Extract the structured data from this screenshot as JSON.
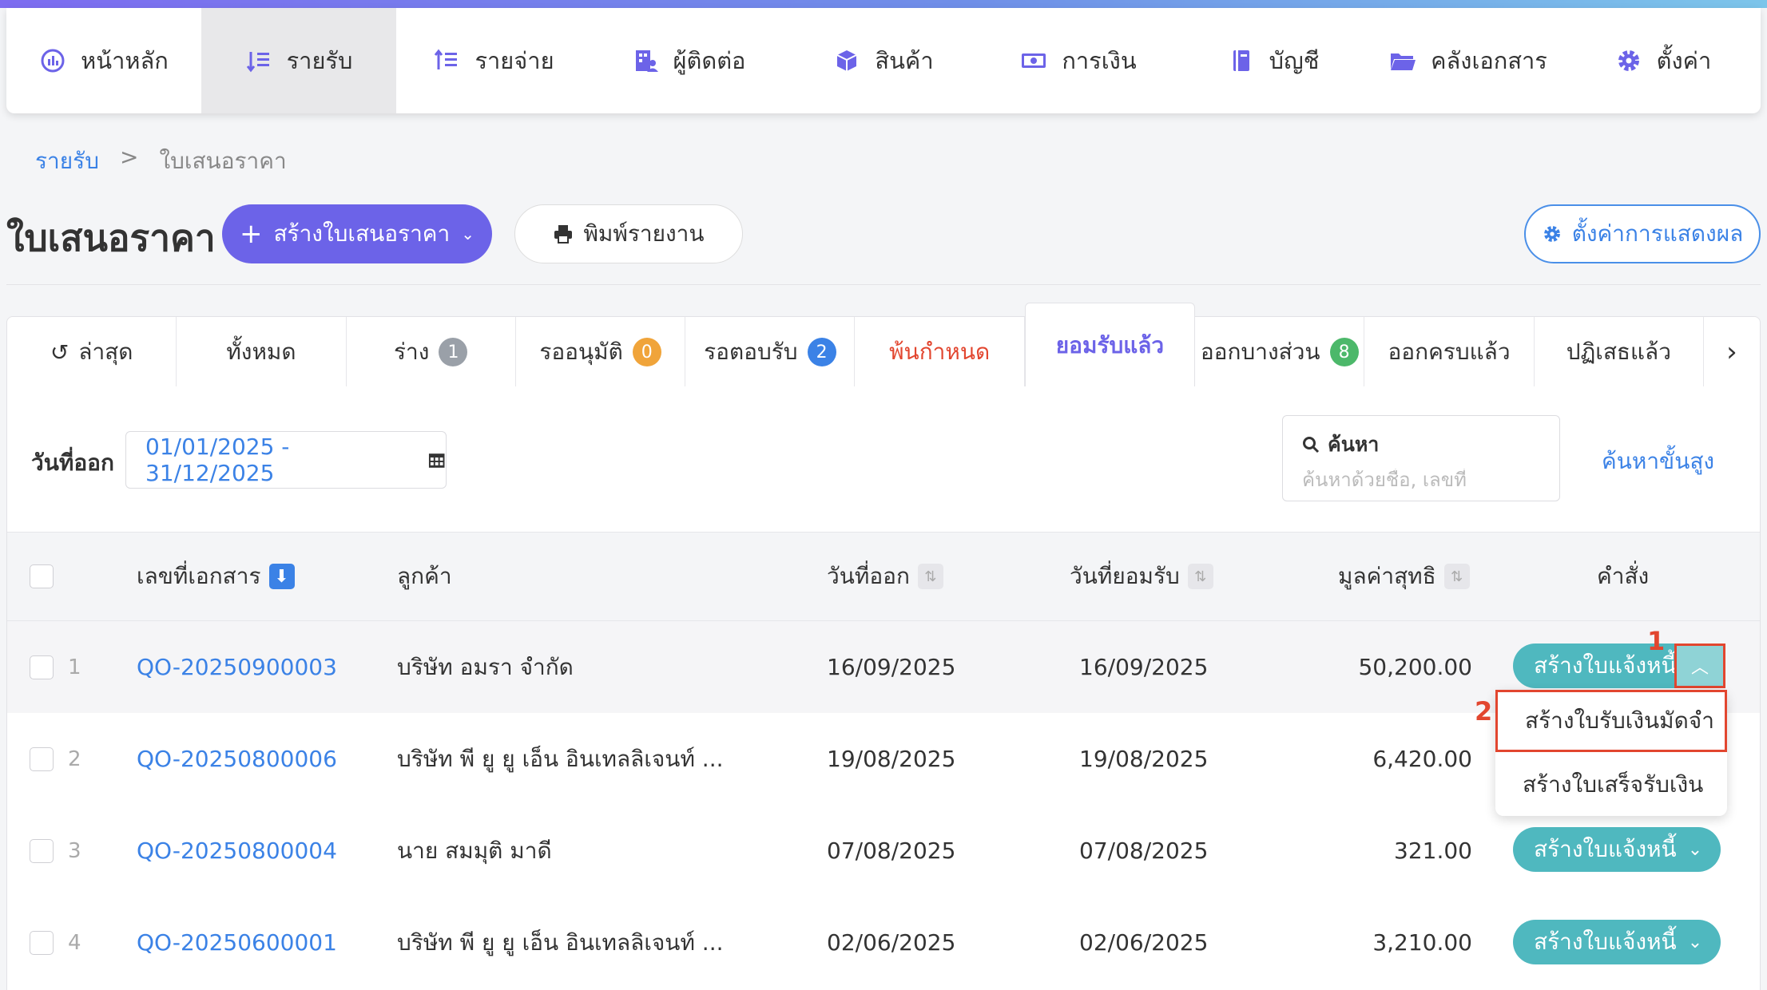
{
  "nav": [
    {
      "label": "หน้าหลัก",
      "icon": "dashboard-icon",
      "active": false
    },
    {
      "label": "รายรับ",
      "icon": "income-icon",
      "active": true
    },
    {
      "label": "รายจ่าย",
      "icon": "expense-icon",
      "active": false
    },
    {
      "label": "ผู้ติดต่อ",
      "icon": "contacts-icon",
      "active": false
    },
    {
      "label": "สินค้า",
      "icon": "box-icon",
      "active": false
    },
    {
      "label": "การเงิน",
      "icon": "money-icon",
      "active": false
    },
    {
      "label": "บัญชี",
      "icon": "ledger-icon",
      "active": false
    },
    {
      "label": "คลังเอกสาร",
      "icon": "folder-icon",
      "active": false
    },
    {
      "label": "ตั้งค่า",
      "icon": "gear-icon",
      "active": false
    }
  ],
  "breadcrumb": {
    "parent": "รายรับ",
    "sep": ">",
    "current": "ใบเสนอราคา"
  },
  "header": {
    "title": "ใบเสนอราคา",
    "create_label": "สร้างใบเสนอราคา",
    "print_label": "พิมพ์รายงาน",
    "settings_label": "ตั้งค่าการแสดงผล"
  },
  "tabs": [
    {
      "label": "ล่าสุด",
      "badge": null
    },
    {
      "label": "ทั้งหมด",
      "badge": null
    },
    {
      "label": "ร่าง",
      "badge": "1",
      "badge_color": "#9aa0a8"
    },
    {
      "label": "รออนุมัติ",
      "badge": "0",
      "badge_color": "#f0a43a"
    },
    {
      "label": "รอตอบรับ",
      "badge": "2",
      "badge_color": "#3b82e6"
    },
    {
      "label": "พ้นกำหนด",
      "badge": null
    },
    {
      "label": "ยอมรับแล้ว",
      "badge": null
    },
    {
      "label": "ออกบางส่วน",
      "badge": "8",
      "badge_color": "#4cb86a"
    },
    {
      "label": "ออกครบแล้ว",
      "badge": null
    },
    {
      "label": "ปฏิเสธแล้ว",
      "badge": null
    }
  ],
  "filters": {
    "date_label": "วันที่ออก",
    "date_range": "01/01/2025 - 31/12/2025",
    "search_label": "ค้นหา",
    "search_placeholder": "ค้นหาด้วยชื่อ, เลขที่",
    "advanced_label": "ค้นหาขั้นสูง"
  },
  "table": {
    "headers": {
      "doc_no": "เลขที่เอกสาร",
      "customer": "ลูกค้า",
      "issue_date": "วันที่ออก",
      "accept_date": "วันที่ยอมรับ",
      "net_value": "มูลค่าสุทธิ",
      "action": "คำสั่ง"
    },
    "rows": [
      {
        "n": "1",
        "doc": "QO-20250900003",
        "customer": "บริษัท อมรา จำกัด",
        "issue": "16/09/2025",
        "accept": "16/09/2025",
        "value": "50,200.00"
      },
      {
        "n": "2",
        "doc": "QO-20250800006",
        "customer": "บริษัท พี ยู ยู เอ็น อินเทลลิเจนท์ ...",
        "issue": "19/08/2025",
        "accept": "19/08/2025",
        "value": "6,420.00"
      },
      {
        "n": "3",
        "doc": "QO-20250800004",
        "customer": "นาย สมมุติ มาดี",
        "issue": "07/08/2025",
        "accept": "07/08/2025",
        "value": "321.00"
      },
      {
        "n": "4",
        "doc": "QO-20250600001",
        "customer": "บริษัท พี ยู ยู เอ็น อินเทลลิเจนท์ ...",
        "issue": "02/06/2025",
        "accept": "02/06/2025",
        "value": "3,210.00"
      }
    ],
    "action_label": "สร้างใบแจ้งหนี้"
  },
  "dropdown": {
    "items": [
      "สร้างใบรับเงินมัดจำ",
      "สร้างใบเสร็จรับเงิน"
    ]
  },
  "annotations": {
    "step1": "1",
    "step2": "2"
  }
}
